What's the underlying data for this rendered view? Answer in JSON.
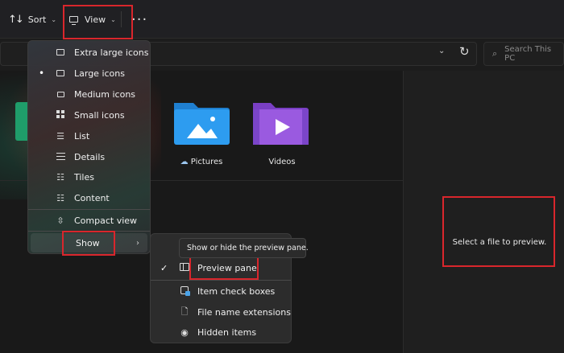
{
  "toolbar": {
    "sort_label": "Sort",
    "view_label": "View",
    "more_label": "···"
  },
  "search": {
    "placeholder": "Search This PC"
  },
  "folders": [
    {
      "label": "Pictures",
      "has_cloud_icon": true
    },
    {
      "label": "Videos"
    }
  ],
  "preview": {
    "empty_text": "Select a file to preview."
  },
  "view_menu": {
    "items": [
      {
        "label": "Extra large icons",
        "icon": "monitor-icon",
        "selected": false
      },
      {
        "label": "Large icons",
        "icon": "monitor-icon",
        "selected": true
      },
      {
        "label": "Medium icons",
        "icon": "monitor-small-icon",
        "selected": false
      },
      {
        "label": "Small icons",
        "icon": "small-icons-icon",
        "selected": false
      },
      {
        "label": "List",
        "icon": "list-icon",
        "selected": false
      },
      {
        "label": "Details",
        "icon": "details-icon",
        "selected": false
      },
      {
        "label": "Tiles",
        "icon": "tiles-icon",
        "selected": false
      },
      {
        "label": "Content",
        "icon": "content-icon",
        "selected": false
      }
    ],
    "compact_label": "Compact view",
    "show_label": "Show"
  },
  "show_menu": {
    "items": [
      {
        "label": "Preview pane",
        "checked": true,
        "icon": "preview-pane-icon"
      },
      {
        "label": "Item check boxes",
        "checked": false,
        "icon": "checkbox-icon"
      },
      {
        "label": "File name extensions",
        "checked": false,
        "icon": "file-icon"
      },
      {
        "label": "Hidden items",
        "checked": false,
        "icon": "eye-icon"
      }
    ]
  },
  "tooltip": {
    "text": "Show or hide the preview pane."
  },
  "colors": {
    "highlight_border": "#d9262c",
    "accent": "#4aa3e8",
    "folder_blue": "#2d9cf0",
    "folder_purple": "#9a5ae0"
  }
}
